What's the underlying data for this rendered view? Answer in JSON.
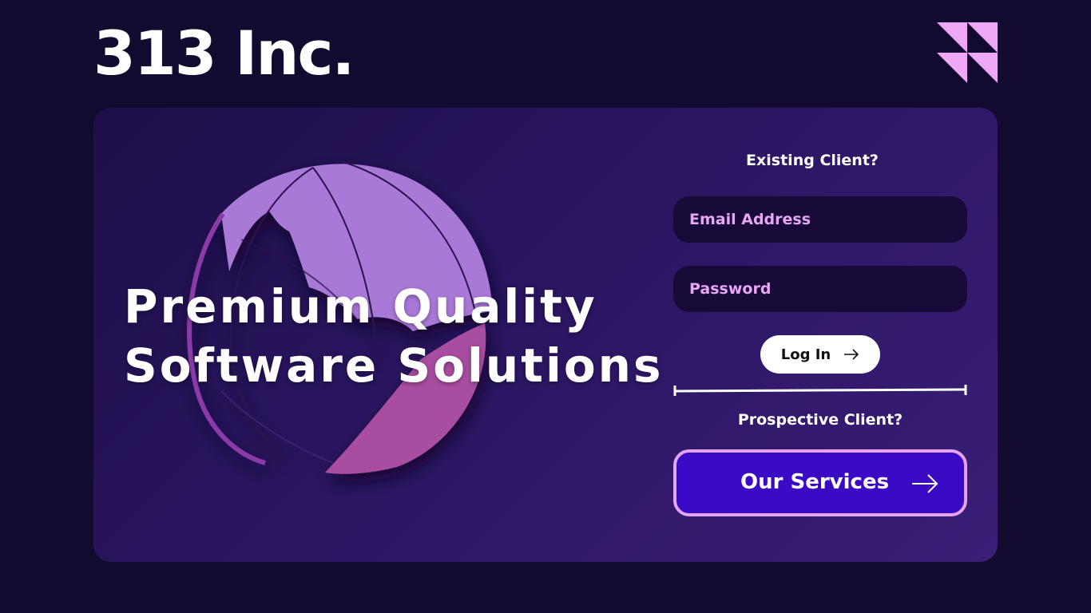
{
  "header": {
    "company_name": "313 Inc.",
    "logo_icon": "triangles-logo-icon"
  },
  "hero": {
    "line1": "Premium Quality",
    "line2": "Software Solutions",
    "image": "globe-illustration"
  },
  "login": {
    "existing_label": "Existing Client?",
    "email_placeholder": "Email Address",
    "password_placeholder": "Password",
    "login_label": "Log In",
    "login_icon": "arrow-right-icon"
  },
  "prospective": {
    "label": "Prospective Client?",
    "services_label": "Our Services",
    "services_icon": "arrow-right-icon"
  },
  "colors": {
    "background": "#130a2f",
    "card": "#2a1560",
    "accent_pink": "#e6a4f6",
    "services_button": "#3a0ac4",
    "input_bg": "#170938"
  }
}
